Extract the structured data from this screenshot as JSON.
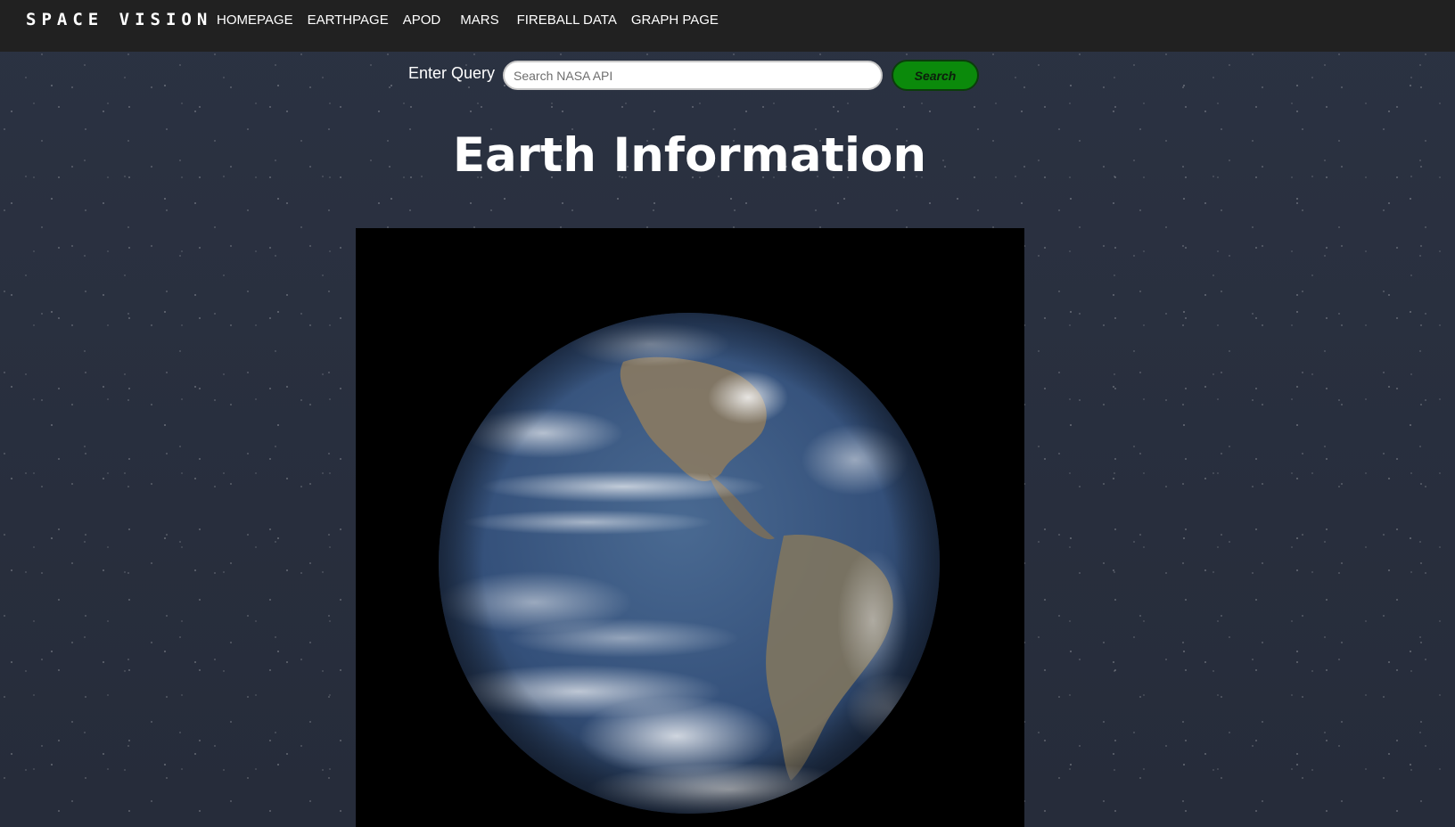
{
  "header": {
    "brand": "SPACE VISION",
    "nav": [
      {
        "label": "HOMEPAGE"
      },
      {
        "label": "EARTHPAGE"
      },
      {
        "label": "APOD"
      },
      {
        "label": "MARS"
      },
      {
        "label": "FIREBALL DATA"
      },
      {
        "label": "GRAPH PAGE"
      }
    ]
  },
  "search": {
    "label": "Enter Query",
    "placeholder": "Search NASA API",
    "value": "",
    "button_label": "Search"
  },
  "main": {
    "title": "Earth Information"
  },
  "colors": {
    "topbar": "#212121",
    "search_button": "#0b8a0b",
    "ocean": "#3d5a80",
    "land": "#8a7a62"
  }
}
